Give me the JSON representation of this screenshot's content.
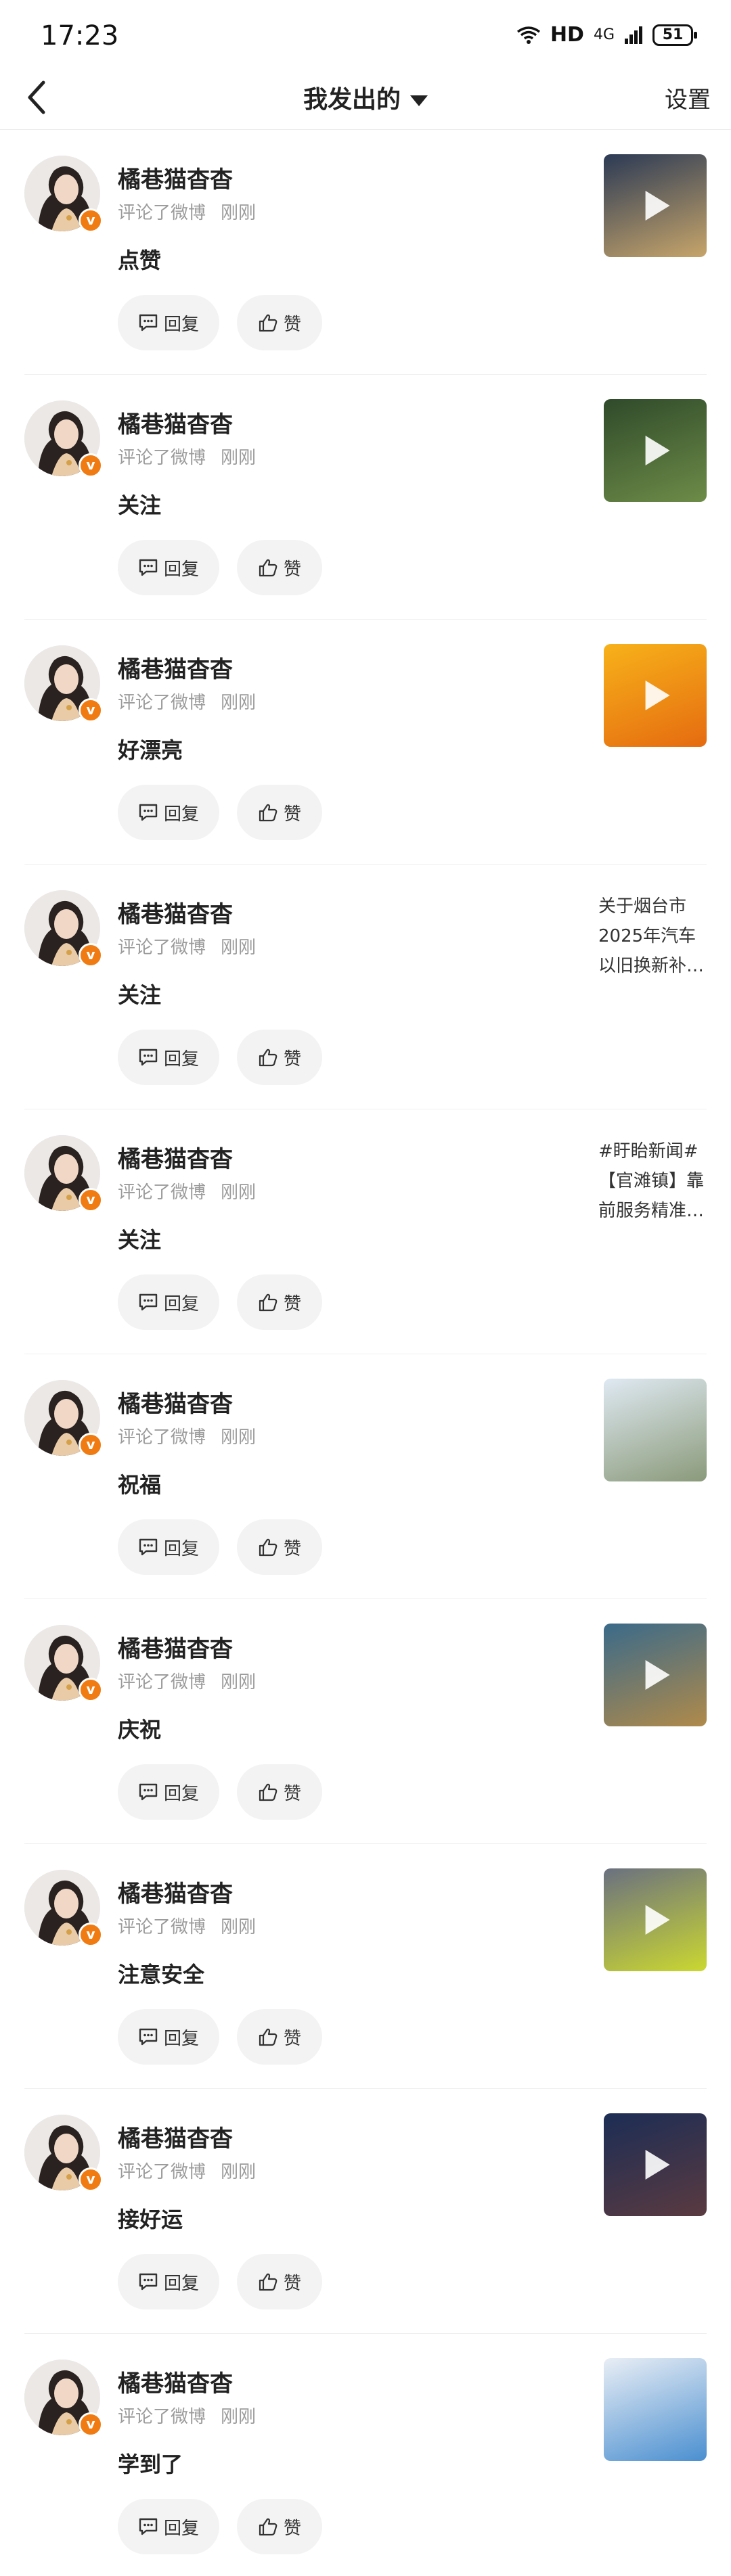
{
  "status_bar": {
    "time": "17:23",
    "network": "HD",
    "signal": "4G",
    "battery": "51"
  },
  "header": {
    "title": "我发出的",
    "settings_label": "设置"
  },
  "actions": {
    "reply_label": "回复",
    "like_label": "赞"
  },
  "items": [
    {
      "user": "橘巷猫杳杳",
      "action": "评论了微博",
      "time": "刚刚",
      "comment": "点赞",
      "thumb_kind": "video",
      "thumb_colors": [
        "#2b3a55",
        "#c7a56a"
      ],
      "thumb_text": ""
    },
    {
      "user": "橘巷猫杳杳",
      "action": "评论了微博",
      "time": "刚刚",
      "comment": "关注",
      "thumb_kind": "video",
      "thumb_colors": [
        "#2f4a2a",
        "#6d8c48"
      ],
      "thumb_text": ""
    },
    {
      "user": "橘巷猫杳杳",
      "action": "评论了微博",
      "time": "刚刚",
      "comment": "好漂亮",
      "thumb_kind": "video",
      "thumb_colors": [
        "#f7b21a",
        "#e56b10"
      ],
      "thumb_text": ""
    },
    {
      "user": "橘巷猫杳杳",
      "action": "评论了微博",
      "time": "刚刚",
      "comment": "关注",
      "thumb_kind": "text",
      "thumb_colors": [],
      "thumb_text": "关于烟台市2025年汽车以旧换新补…"
    },
    {
      "user": "橘巷猫杳杳",
      "action": "评论了微博",
      "time": "刚刚",
      "comment": "关注",
      "thumb_kind": "text",
      "thumb_colors": [],
      "thumb_text": "#盱眙新闻#【官滩镇】靠前服务精准…"
    },
    {
      "user": "橘巷猫杳杳",
      "action": "评论了微博",
      "time": "刚刚",
      "comment": "祝福",
      "thumb_kind": "image",
      "thumb_colors": [
        "#dfe9f2",
        "#8a9a7a"
      ],
      "thumb_text": ""
    },
    {
      "user": "橘巷猫杳杳",
      "action": "评论了微博",
      "time": "刚刚",
      "comment": "庆祝",
      "thumb_kind": "video",
      "thumb_colors": [
        "#3a6a8a",
        "#b08a4a"
      ],
      "thumb_text": ""
    },
    {
      "user": "橘巷猫杳杳",
      "action": "评论了微博",
      "time": "刚刚",
      "comment": "注意安全",
      "thumb_kind": "video",
      "thumb_colors": [
        "#6a7080",
        "#cbd830"
      ],
      "thumb_text": ""
    },
    {
      "user": "橘巷猫杳杳",
      "action": "评论了微博",
      "time": "刚刚",
      "comment": "接好运",
      "thumb_kind": "video",
      "thumb_colors": [
        "#1c2d55",
        "#5a3a40"
      ],
      "thumb_text": ""
    },
    {
      "user": "橘巷猫杳杳",
      "action": "评论了微博",
      "time": "刚刚",
      "comment": "学到了",
      "thumb_kind": "image",
      "thumb_colors": [
        "#e9eef5",
        "#4a8fd0"
      ],
      "thumb_text": ""
    }
  ]
}
